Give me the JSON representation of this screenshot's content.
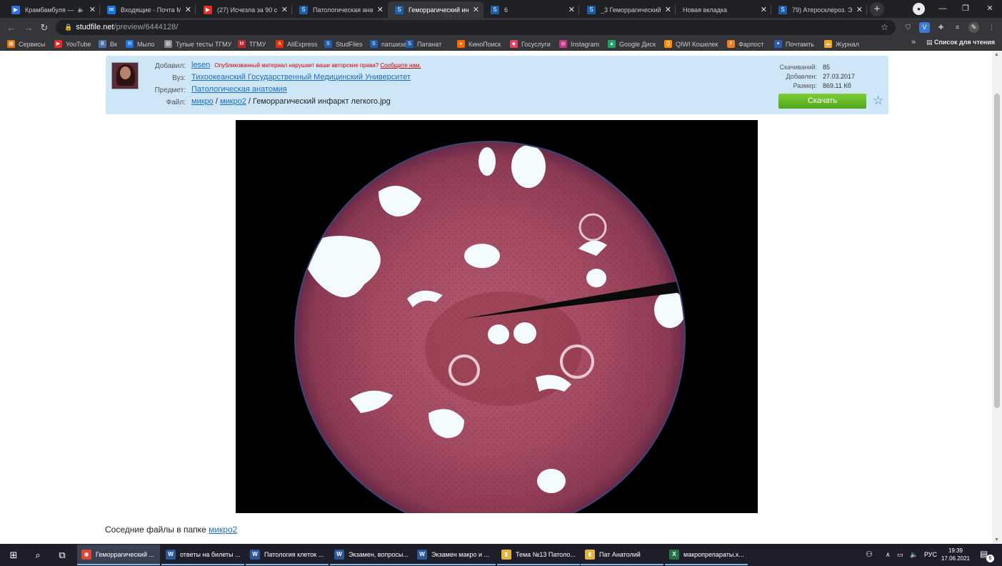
{
  "tabs": [
    {
      "title": "Крамбамбуля — Ты",
      "icon": "play-icon",
      "color": "#2f6fe0",
      "glyph": "▶",
      "extra": "🔈"
    },
    {
      "title": "Входящие - Почта Ма",
      "icon": "mail-icon",
      "color": "#1a73e8",
      "glyph": "✉"
    },
    {
      "title": "(27) Исчезла за 90 сек",
      "icon": "youtube-icon",
      "color": "#e52d27",
      "glyph": "▶"
    },
    {
      "title": "Патологическая анат",
      "icon": "studfile-icon",
      "color": "#1d5fa8",
      "glyph": "S"
    },
    {
      "title": "Геморрагический инф",
      "icon": "studfile-icon",
      "color": "#1d5fa8",
      "glyph": "S"
    },
    {
      "title": "6",
      "icon": "studfile-icon",
      "color": "#1d5fa8",
      "glyph": "S"
    },
    {
      "title": "_3 Геморрагический",
      "icon": "studfile-icon",
      "color": "#1d5fa8",
      "glyph": "S"
    },
    {
      "title": "Новая вкладка",
      "icon": "",
      "color": "",
      "glyph": ""
    },
    {
      "title": "79) Атеросклероз. Эт",
      "icon": "studfile-icon",
      "color": "#1d5fa8",
      "glyph": "S"
    }
  ],
  "toolbar": {
    "url_host": "studfile.net",
    "url_path": "/preview/6444128/"
  },
  "bookmarks": [
    {
      "label": "Сервисы",
      "icon": "apps-grid-icon",
      "color": "#e8710a",
      "glyph": "▦"
    },
    {
      "label": "YouTube",
      "icon": "youtube-icon",
      "color": "#e52d27",
      "glyph": "▶"
    },
    {
      "label": "Вк",
      "icon": "vk-icon",
      "color": "#4a76a8",
      "glyph": "B"
    },
    {
      "label": "Мыло",
      "icon": "mail-icon",
      "color": "#1a73e8",
      "glyph": "✉"
    },
    {
      "label": "Тупые тесты ТГМУ",
      "icon": "page-icon",
      "color": "#888",
      "glyph": "▤"
    },
    {
      "label": "ТГМУ",
      "icon": "tgmu-icon",
      "color": "#c0262b",
      "glyph": "M"
    },
    {
      "label": "AliExpress",
      "icon": "aliexpress-icon",
      "color": "#e62e04",
      "glyph": "A"
    },
    {
      "label": "StudFiles",
      "icon": "studfile-icon",
      "color": "#1d5fa8",
      "glyph": "S"
    },
    {
      "label": "патшиза",
      "icon": "studfile-icon",
      "color": "#1d5fa8",
      "glyph": "S"
    },
    {
      "label": "Патанат",
      "icon": "studfile-icon",
      "color": "#1d5fa8",
      "glyph": "S"
    },
    {
      "label": "КиноПоиск",
      "icon": "kinopoisk-icon",
      "color": "#f60",
      "glyph": "●"
    },
    {
      "label": "Госуслуги",
      "icon": "gosuslugi-icon",
      "color": "#ee3f58",
      "glyph": "◆"
    },
    {
      "label": "Instagram",
      "icon": "instagram-icon",
      "color": "#c13584",
      "glyph": "◎"
    },
    {
      "label": "Google Диск",
      "icon": "drive-icon",
      "color": "#1fa463",
      "glyph": "▲"
    },
    {
      "label": "QIWI Кошелек",
      "icon": "qiwi-icon",
      "color": "#ff8c00",
      "glyph": "Q"
    },
    {
      "label": "Фарпост",
      "icon": "farpost-icon",
      "color": "#f27a1a",
      "glyph": "F"
    },
    {
      "label": "Почтамть",
      "icon": "pochta-icon",
      "color": "#2a5aa8",
      "glyph": "✦"
    },
    {
      "label": "Журнал",
      "icon": "journal-icon",
      "color": "#f5a623",
      "glyph": "☁"
    }
  ],
  "reading_list": "Список для чтения",
  "fileinfo": {
    "added_label": "Добавил:",
    "added_user": "lesen",
    "warning_text": "Опубликованный материал нарушает ваши авторские права?",
    "warning_link": "Сообщите нам.",
    "university_label": "Вуз:",
    "university": "Тихоокеанский Государственный Медицинский Университет",
    "subject_label": "Предмет:",
    "subject": "Патологическая анатомия",
    "file_label": "Файл:",
    "file_path_1": "микро",
    "file_sep": " / ",
    "file_path_2": "микро2",
    "file_name": " / Геморрагический инфаркт легкого.jpg",
    "downloads_label": "Скачиваний:",
    "downloads": "85",
    "added_date_label": "Добавлен:",
    "added_date": "27.03.2017",
    "size_label": "Размер:",
    "size": "869.11 Кб",
    "download_button": "Скачать"
  },
  "neighbors": {
    "text": "Соседние файлы в папке ",
    "folder": "микро2"
  },
  "taskbar": {
    "items": [
      {
        "label": "Геморрагический ...",
        "icon": "chrome-icon",
        "color": "#db4437",
        "glyph": "◉",
        "active": true
      },
      {
        "label": "ответы на билеты ...",
        "icon": "word-icon",
        "color": "#2b579a",
        "glyph": "W"
      },
      {
        "label": "Патология клеток ...",
        "icon": "word-icon",
        "color": "#2b579a",
        "glyph": "W"
      },
      {
        "label": "Экзамен, вопросы...",
        "icon": "word-icon",
        "color": "#2b579a",
        "glyph": "W"
      },
      {
        "label": "Экзамен макро и ...",
        "icon": "word-icon",
        "color": "#2b579a",
        "glyph": "W"
      },
      {
        "label": "Тема №13 Патоло...",
        "icon": "folder-icon",
        "color": "#e8b33a",
        "glyph": "▮"
      },
      {
        "label": "Пат Анатолий",
        "icon": "folder-icon",
        "color": "#e8b33a",
        "glyph": "▮"
      },
      {
        "label": "макропрепараты.х...",
        "icon": "excel-icon",
        "color": "#217346",
        "glyph": "X"
      }
    ],
    "lang": "РУС",
    "time": "19:39",
    "date": "17.06.2021",
    "notifications": "6"
  }
}
